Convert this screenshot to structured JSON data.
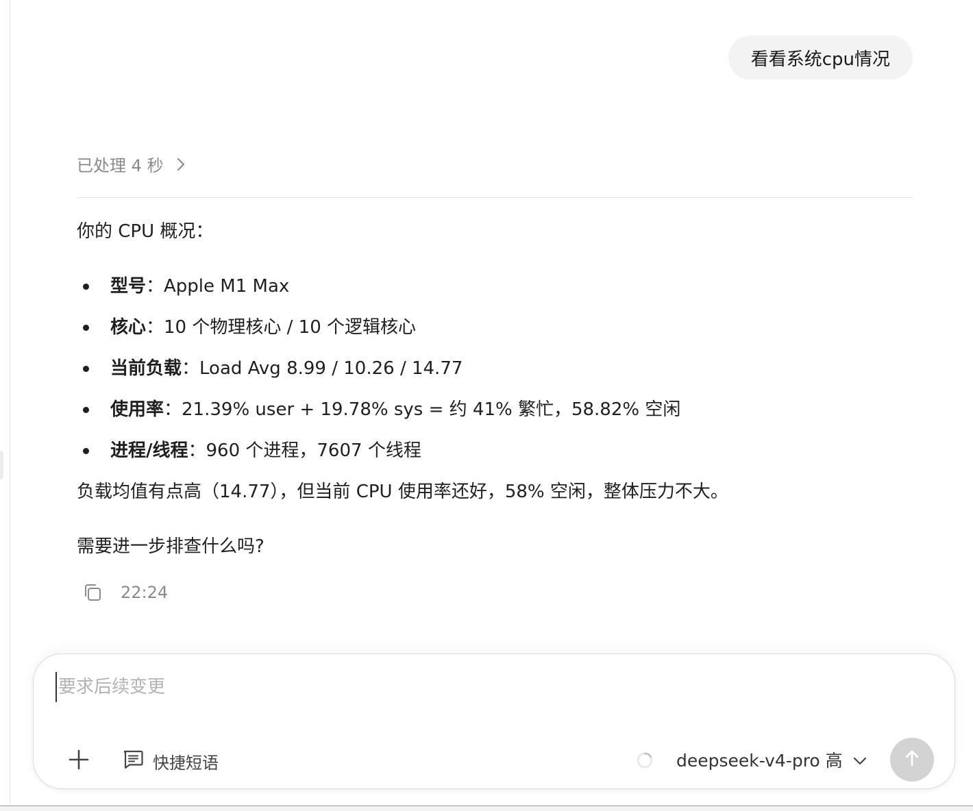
{
  "user_message": "看看系统cpu情况",
  "processed": {
    "label": "已处理 4 秒",
    "icon": "chevron-right-icon"
  },
  "response": {
    "intro": "你的 CPU 概况：",
    "bullets": [
      {
        "label": "型号",
        "value": "：Apple M1 Max"
      },
      {
        "label": "核心",
        "value": "：10 个物理核心 / 10 个逻辑核心"
      },
      {
        "label": "当前负载",
        "value": "：Load Avg 8.99 / 10.26 / 14.77"
      },
      {
        "label": "使用率",
        "value": "：21.39% user + 19.78% sys = 约 41% 繁忙，58.82% 空闲"
      },
      {
        "label": "进程/线程",
        "value": "：960 个进程，7607 个线程"
      }
    ],
    "summary": "负载均值有点高（14.77），但当前 CPU 使用率还好，58% 空闲，整体压力不大。",
    "question": "需要进一步排查什么吗?"
  },
  "meta": {
    "time": "22:24",
    "copy_icon": "copy-icon"
  },
  "composer": {
    "placeholder": "要求后续变更",
    "quick_phrases_label": "快捷短语",
    "model_label": "deepseek-v4-pro 高",
    "icons": [
      "plus-icon",
      "message-square-icon",
      "loading-spinner-icon",
      "chevron-down-icon",
      "arrow-up-icon"
    ],
    "send_button_color": "#d3d3d3"
  }
}
